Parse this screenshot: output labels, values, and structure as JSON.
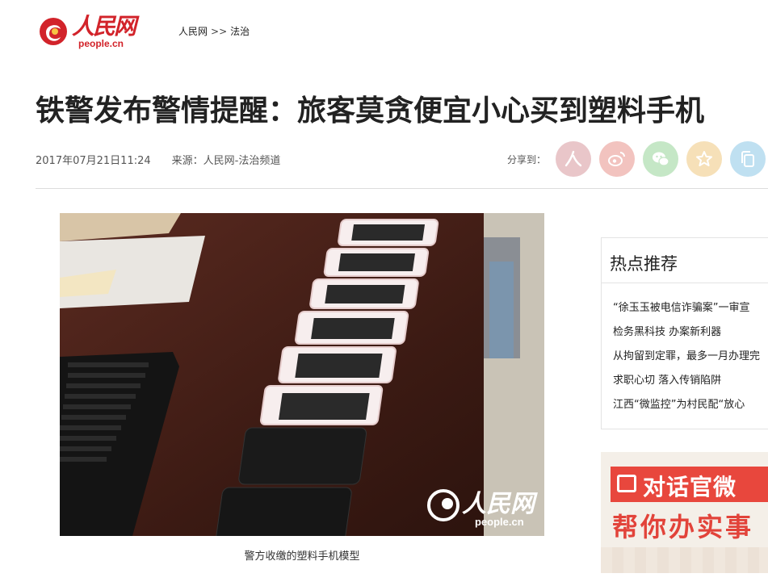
{
  "header": {
    "logo_cn": "人民网",
    "logo_en": "people.cn",
    "breadcrumb": [
      "人民网",
      ">>",
      "法治"
    ]
  },
  "article": {
    "title": "铁警发布警情提醒：旅客莫贪便宜小心买到塑料手机",
    "datetime": "2017年07月21日11:24",
    "source": "来源：人民网-法治频道",
    "share_label": "分享到：",
    "share_icons": [
      "people-icon",
      "weibo-icon",
      "wechat-icon",
      "favorite-icon",
      "copy-icon"
    ],
    "image_watermark_cn": "人民网",
    "image_watermark_en": "people.cn",
    "caption": "警方收缴的塑料手机模型"
  },
  "sidebar": {
    "hot_title": "热点推荐",
    "hot_items": [
      "“徐玉玉被电信诈骗案”一审宣",
      "检务黑科技 办案新利器",
      "从拘留到定罪，最多一月办理完",
      "求职心切 落入传销陷阱",
      "江西“微监控”为村民配“放心"
    ],
    "ad_line1": "对话官微",
    "ad_line2": "帮你办实事"
  },
  "colors": {
    "brand_red": "#d2232a",
    "share_people": "#e9c6c9",
    "share_weibo": "#f2c3bf",
    "share_wechat": "#c5e7c6",
    "share_favorite": "#f6e0b8",
    "share_copy": "#bfe0f1"
  }
}
